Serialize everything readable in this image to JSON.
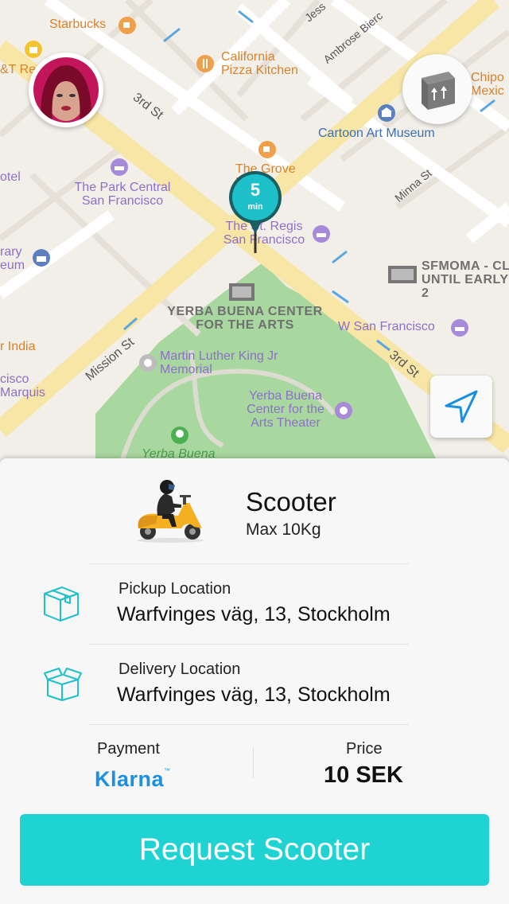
{
  "map": {
    "labels": {
      "starbucks": "Starbucks",
      "california_pizza_kitchen": "California Pizza Kitchen",
      "chipotle": "Chipo Mexic",
      "cartoon_art_museum": "Cartoon Art Museum",
      "the_grove": "The Grove Buena",
      "park_central": "The Park Central San Francisco",
      "st_regis": "The St. Regis San Francisco",
      "sfmoma": "SFMOMA - CL UNTIL EARLY 2",
      "yerba_buena_center": "YERBA BUENA CENTER FOR THE ARTS",
      "w_san_francisco": "W San Francisco",
      "mlk_memorial": "Martin Luther King Jr Memorial",
      "yerba_buena_theater": "Yerba Buena Center for the Arts Theater",
      "yerba_buena_park": "Yerba Buena",
      "hotel_left": "otel",
      "library_museum": "rary eum",
      "india": "r India",
      "marquis": "cisco Marquis",
      "kt_re": "&T Re",
      "street_3rd_top": "3rd St",
      "street_3rd_right": "3rd St",
      "street_mission": "Mission St",
      "street_minna": "Minna St",
      "street_jessie": "Jess",
      "street_ambrose": "Ambrose Bierc"
    },
    "eta": {
      "value": "5",
      "unit": "min"
    }
  },
  "vehicle": {
    "name": "Scooter",
    "capacity": "Max 10Kg"
  },
  "pickup": {
    "label": "Pickup Location",
    "value": "Warfvinges väg, 13, Stockholm"
  },
  "delivery": {
    "label": "Delivery Location",
    "value": "Warfvinges väg, 13, Stockholm"
  },
  "payment": {
    "label": "Payment",
    "method": "Klarna"
  },
  "price": {
    "label": "Price",
    "value": "10 SEK"
  },
  "cta": {
    "label": "Request Scooter"
  },
  "colors": {
    "accent": "#1fd3d3",
    "pin": "#1ec0c9",
    "klarna": "#1d8fe0",
    "park": "#a8d8a0"
  },
  "icons": [
    "user-avatar",
    "box-icon",
    "location-arrow-icon",
    "scooter-icon",
    "pickup-box-icon",
    "delivery-box-icon"
  ]
}
